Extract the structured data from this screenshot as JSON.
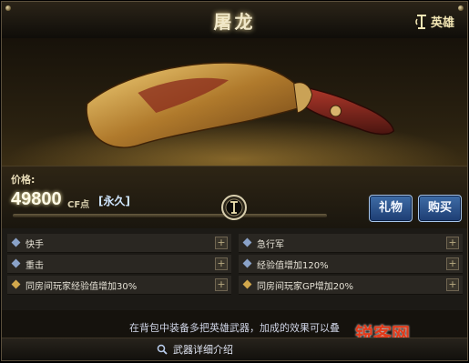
{
  "header": {
    "title": "屠龙",
    "rank_label": "英雄"
  },
  "price": {
    "label": "价格:",
    "value": "49800",
    "unit": "CF点",
    "duration": "[永久]"
  },
  "buttons": {
    "gift": "礼物",
    "buy": "购买"
  },
  "attributes": {
    "left": [
      {
        "text": "快手",
        "bullet": "blue-diamond-icon"
      },
      {
        "text": "重击",
        "bullet": "blue-diamond-icon"
      },
      {
        "text": "同房间玩家经验值增加30%",
        "bullet": "gold-diamond-icon"
      }
    ],
    "right": [
      {
        "text": "急行军",
        "bullet": "blue-diamond-icon"
      },
      {
        "text": "经验值增加120%",
        "bullet": "blue-diamond-icon"
      },
      {
        "text": "同房间玩家GP增加20%",
        "bullet": "gold-diamond-icon"
      }
    ]
  },
  "notice": "在背包中装备多把英雄武器，加成的效果可以叠",
  "footer": {
    "detail_link": "武器详细介绍"
  },
  "watermark": "锐客网",
  "colors": {
    "accent_gold": "#d2a84c",
    "button_blue": "#2b5590",
    "background": "#15120d"
  }
}
